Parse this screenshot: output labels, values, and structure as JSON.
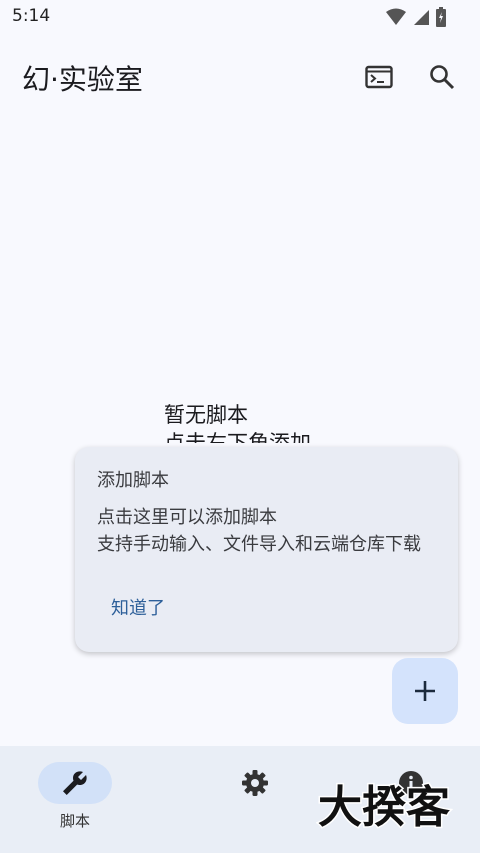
{
  "status_bar": {
    "time": "5:14"
  },
  "app_bar": {
    "title": "幻·实验室",
    "actions": [
      "terminal-icon",
      "search-icon"
    ]
  },
  "empty_state": {
    "line1": "暂无脚本",
    "line2": "点击右下角添加"
  },
  "tooltip": {
    "title": "添加脚本",
    "body_line1": "点击这里可以添加脚本",
    "body_line2": "支持手动输入、文件导入和云端仓库下载",
    "ok_label": "知道了"
  },
  "fab": {
    "icon": "plus-icon"
  },
  "bottom_nav": {
    "items": [
      {
        "label": "脚本",
        "icon": "wrench-icon",
        "active": true
      },
      {
        "label": "",
        "icon": "gear-icon",
        "active": false
      },
      {
        "label": "",
        "icon": "info-icon",
        "active": false
      }
    ]
  },
  "watermark": {
    "text": "大揆客"
  },
  "colors": {
    "background": "#f8f9fe",
    "nav_bg": "#e9eef6",
    "fab_bg": "#d4e3fc",
    "accent": "#2d5f99"
  }
}
